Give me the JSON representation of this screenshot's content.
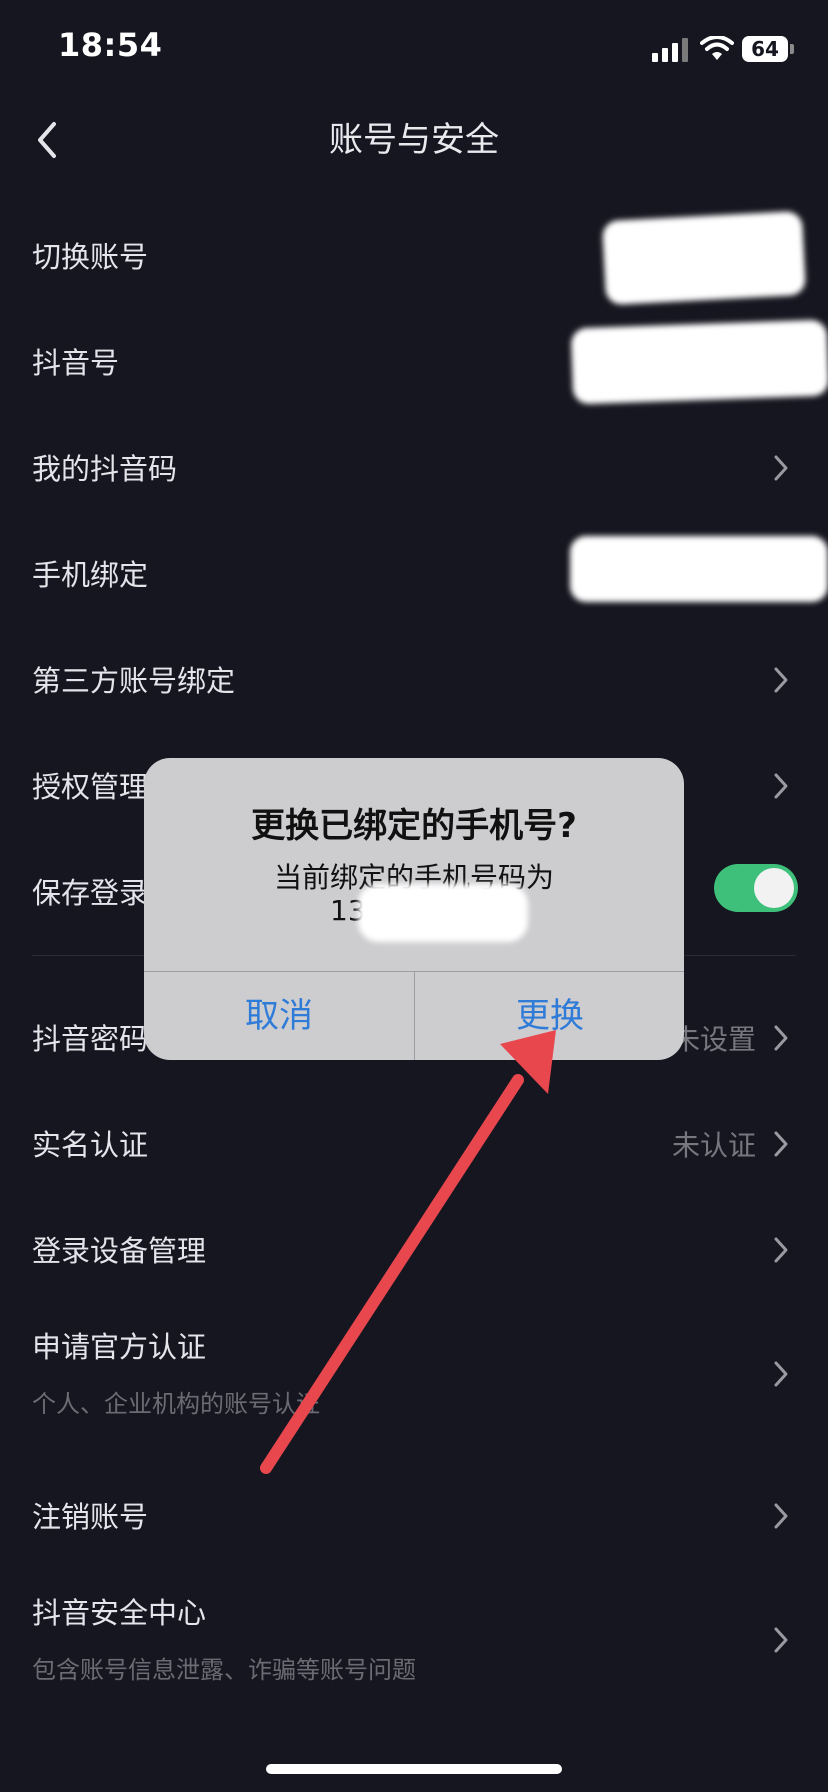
{
  "status_bar": {
    "time": "18:54",
    "battery": "64"
  },
  "nav": {
    "title": "账号与安全"
  },
  "rows": {
    "switch_account": "切换账号",
    "douyin_id": "抖音号",
    "my_qrcode": "我的抖音码",
    "phone_binding": "手机绑定",
    "third_party": "第三方账号绑定",
    "authorization": "授权管理",
    "save_login": "保存登录",
    "douyin_password": "抖音密码",
    "douyin_password_value": "未设置",
    "real_name": "实名认证",
    "real_name_value": "未认证",
    "device_mgmt": "登录设备管理",
    "official_verify": "申请官方认证",
    "official_verify_sub": "个人、企业机构的账号认证",
    "cancel_account": "注销账号",
    "security_center": "抖音安全中心",
    "security_center_sub": "包含账号信息泄露、诈骗等账号问题"
  },
  "dialog": {
    "title": "更换已绑定的手机号?",
    "message_line1": "当前绑定的手机号码为",
    "message_line2": "13",
    "cancel_label": "取消",
    "confirm_label": "更换"
  },
  "colors": {
    "background": "#161620",
    "dialog_bg": "#cdcdd0",
    "dialog_button": "#2f7bd8",
    "toggle_on": "#3ec07a",
    "annotation_arrow": "#e8474e"
  },
  "icons": {
    "back": "chevron-left-icon",
    "chevron": "chevron-right-icon"
  }
}
